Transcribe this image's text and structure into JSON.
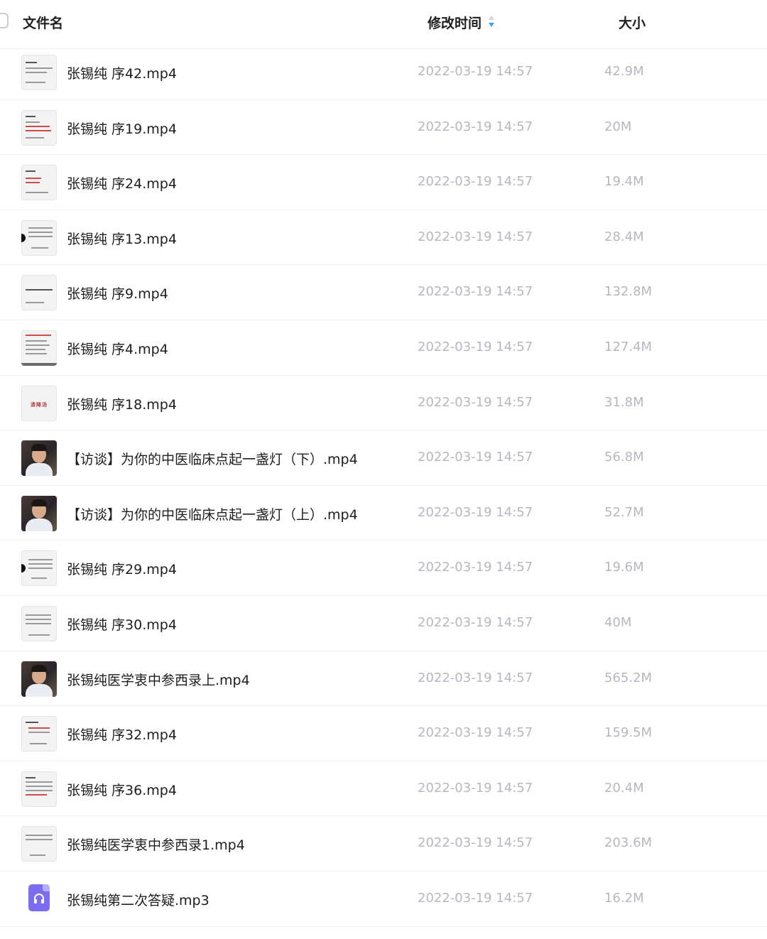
{
  "header": {
    "name_label": "文件名",
    "time_label": "修改时间",
    "size_label": "大小"
  },
  "colors": {
    "sort_icon": "#3aa0e8",
    "audio_icon": "#7c6cf2"
  },
  "files": [
    {
      "name": "张锡纯 序42.mp4",
      "time": "2022-03-19 14:57",
      "size": "42.9M",
      "thumb": "slide"
    },
    {
      "name": "张锡纯 序19.mp4",
      "time": "2022-03-19 14:57",
      "size": "20M",
      "thumb": "slide"
    },
    {
      "name": "张锡纯 序24.mp4",
      "time": "2022-03-19 14:57",
      "size": "19.4M",
      "thumb": "slide"
    },
    {
      "name": "张锡纯 序13.mp4",
      "time": "2022-03-19 14:57",
      "size": "28.4M",
      "thumb": "slide"
    },
    {
      "name": "张锡纯 序9.mp4",
      "time": "2022-03-19 14:57",
      "size": "132.8M",
      "thumb": "slide"
    },
    {
      "name": "张锡纯 序4.mp4",
      "time": "2022-03-19 14:57",
      "size": "127.4M",
      "thumb": "slide"
    },
    {
      "name": "张锡纯 序18.mp4",
      "time": "2022-03-19 14:57",
      "size": "31.8M",
      "thumb": "title",
      "thumb_text": "清降汤"
    },
    {
      "name": "【访谈】为你的中医临床点起一盏灯（下）.mp4",
      "time": "2022-03-19 14:57",
      "size": "56.8M",
      "thumb": "person"
    },
    {
      "name": "【访谈】为你的中医临床点起一盏灯（上）.mp4",
      "time": "2022-03-19 14:57",
      "size": "52.7M",
      "thumb": "person"
    },
    {
      "name": "张锡纯 序29.mp4",
      "time": "2022-03-19 14:57",
      "size": "19.6M",
      "thumb": "slide"
    },
    {
      "name": "张锡纯 序30.mp4",
      "time": "2022-03-19 14:57",
      "size": "40M",
      "thumb": "slide"
    },
    {
      "name": "张锡纯医学衷中参西录上.mp4",
      "time": "2022-03-19 14:57",
      "size": "565.2M",
      "thumb": "person"
    },
    {
      "name": "张锡纯 序32.mp4",
      "time": "2022-03-19 14:57",
      "size": "159.5M",
      "thumb": "slide"
    },
    {
      "name": "张锡纯 序36.mp4",
      "time": "2022-03-19 14:57",
      "size": "20.4M",
      "thumb": "slide"
    },
    {
      "name": "张锡纯医学衷中参西录1.mp4",
      "time": "2022-03-19 14:57",
      "size": "203.6M",
      "thumb": "slide"
    },
    {
      "name": "张锡纯第二次答疑.mp3",
      "time": "2022-03-19 14:57",
      "size": "16.2M",
      "thumb": "audio"
    }
  ]
}
